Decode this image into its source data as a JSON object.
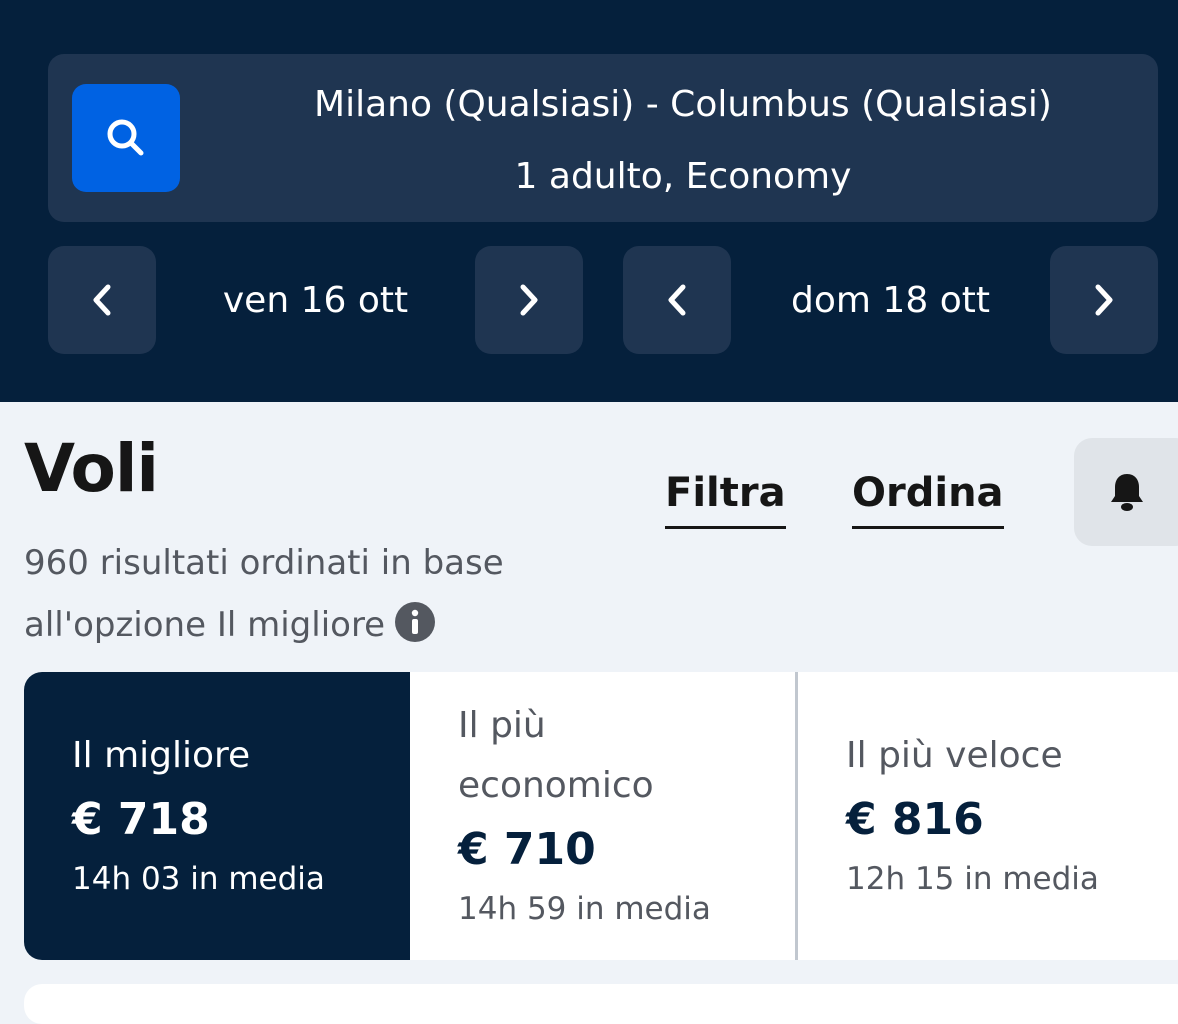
{
  "search": {
    "route": "Milano (Qualsiasi) - Columbus (Qualsiasi)",
    "passengers": "1 adulto, Economy",
    "icon": "search-icon"
  },
  "dates": {
    "outbound": "ven 16 ott",
    "return": "dom 18 ott"
  },
  "results": {
    "title": "Voli",
    "summary_line1": "960 risultati ordinati in base",
    "summary_line2": "all'opzione Il migliore",
    "filter_label": "Filtra",
    "sort_label": "Ordina",
    "bell_icon": "bell-icon",
    "info_icon": "info-icon"
  },
  "sort_tabs": [
    {
      "label": "Il migliore",
      "price": "€ 718",
      "duration": "14h 03 in media",
      "selected": true
    },
    {
      "label_line1": "Il più",
      "label_line2": "economico",
      "price": "€ 710",
      "duration": "14h 59 in media",
      "selected": false
    },
    {
      "label": "Il più veloce",
      "price": "€ 816",
      "duration": "12h 15 in media",
      "selected": false
    }
  ],
  "colors": {
    "header_bg": "#05203c",
    "panel_bg": "#1f3551",
    "accent": "#0062e3",
    "page_bg": "#eff3f8"
  }
}
